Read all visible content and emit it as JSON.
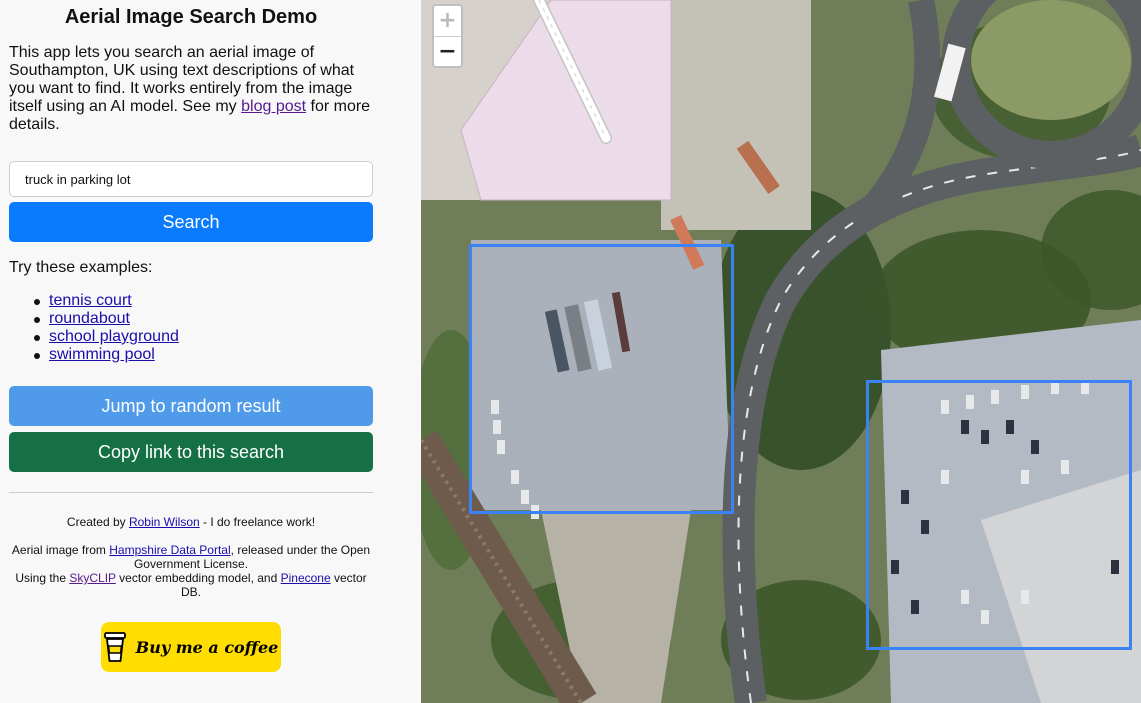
{
  "sidebar": {
    "title": "Aerial Image Search Demo",
    "intro_text": "This app lets you search an aerial image of Southampton, UK using text descriptions of what you want to find. It works entirely from the image itself using an AI model. See my ",
    "intro_link": "blog post",
    "intro_suffix": " for more details.",
    "search_value": "truck in parking lot",
    "search_button": "Search",
    "examples_title": "Try these examples:",
    "examples": [
      "tennis court",
      "roundabout",
      "school playground",
      "swimming pool"
    ],
    "random_button": "Jump to random result",
    "copy_button": "Copy link to this search",
    "footer": {
      "created_prefix": "Created by ",
      "created_link": "Robin Wilson",
      "created_suffix": " - I do freelance work!",
      "aerial_prefix": "Aerial image from ",
      "aerial_link": "Hampshire Data Portal",
      "aerial_suffix": ", released under the Open Government License.",
      "using_prefix": "Using the ",
      "using_link1": "SkyCLIP",
      "using_mid": " vector embedding model, and ",
      "using_link2": "Pinecone",
      "using_suffix": " vector DB."
    },
    "coffee_label": "Buy me a coffee"
  },
  "map": {
    "zoom_in": "+",
    "zoom_out": "−",
    "result_box_color": "#3b82f6"
  }
}
